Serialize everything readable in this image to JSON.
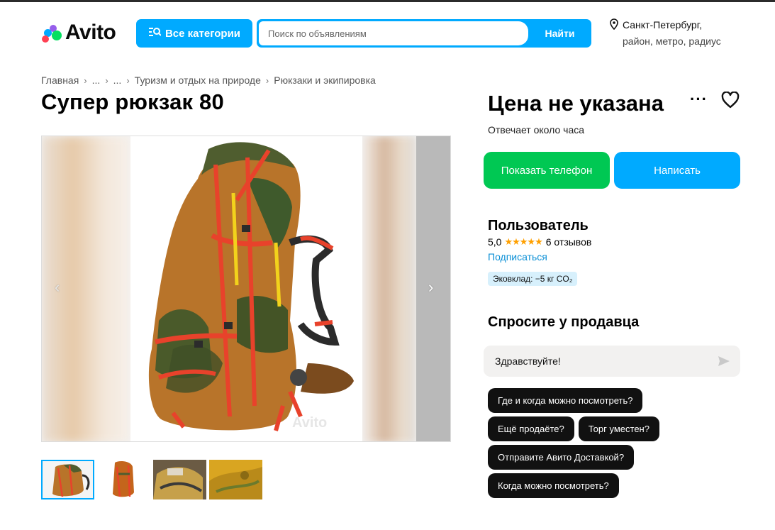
{
  "header": {
    "logo_text": "Avito",
    "categories_label": "Все категории",
    "search": {
      "placeholder": "Поиск по объявлениям",
      "button_label": "Найти"
    },
    "location": {
      "city": "Санкт-Петербург,",
      "sub": "район, метро, радиус"
    }
  },
  "breadcrumbs": [
    {
      "label": "Главная"
    },
    {
      "label": "..."
    },
    {
      "label": "..."
    },
    {
      "label": "Туризм и отдых на природе"
    },
    {
      "label": "Рюкзаки и экипировка"
    }
  ],
  "listing": {
    "title": "Супер рюкзак 80",
    "price": "Цена не указана",
    "reply_time": "Отвечает около часа",
    "watermark": "Avito"
  },
  "actions": {
    "show_phone": "Показать телефон",
    "write": "Написать"
  },
  "seller": {
    "name": "Пользователь",
    "rating_value": "5,0",
    "stars": "★★★★★",
    "reviews": "6 отзывов",
    "subscribe": "Подписаться",
    "eco_badge": "Эковклад: −5 кг CO₂"
  },
  "ask": {
    "title": "Спросите у продавца",
    "message_value": "Здравствуйте!",
    "quick_questions": [
      "Где и когда можно посмотреть?",
      "Ещё продаёте?",
      "Торг уместен?",
      "Отправите Авито Доставкой?",
      "Когда можно посмотреть?"
    ]
  },
  "colors": {
    "accent": "#00aaff",
    "green": "#00c853",
    "chip": "#111111",
    "link": "#0a8fd6",
    "star": "#ffa000"
  },
  "icons": [
    "logo-dots-icon",
    "categories-icon",
    "location-pin-icon",
    "more-icon",
    "heart-icon",
    "send-icon",
    "chevron-left-icon",
    "chevron-right-icon"
  ]
}
